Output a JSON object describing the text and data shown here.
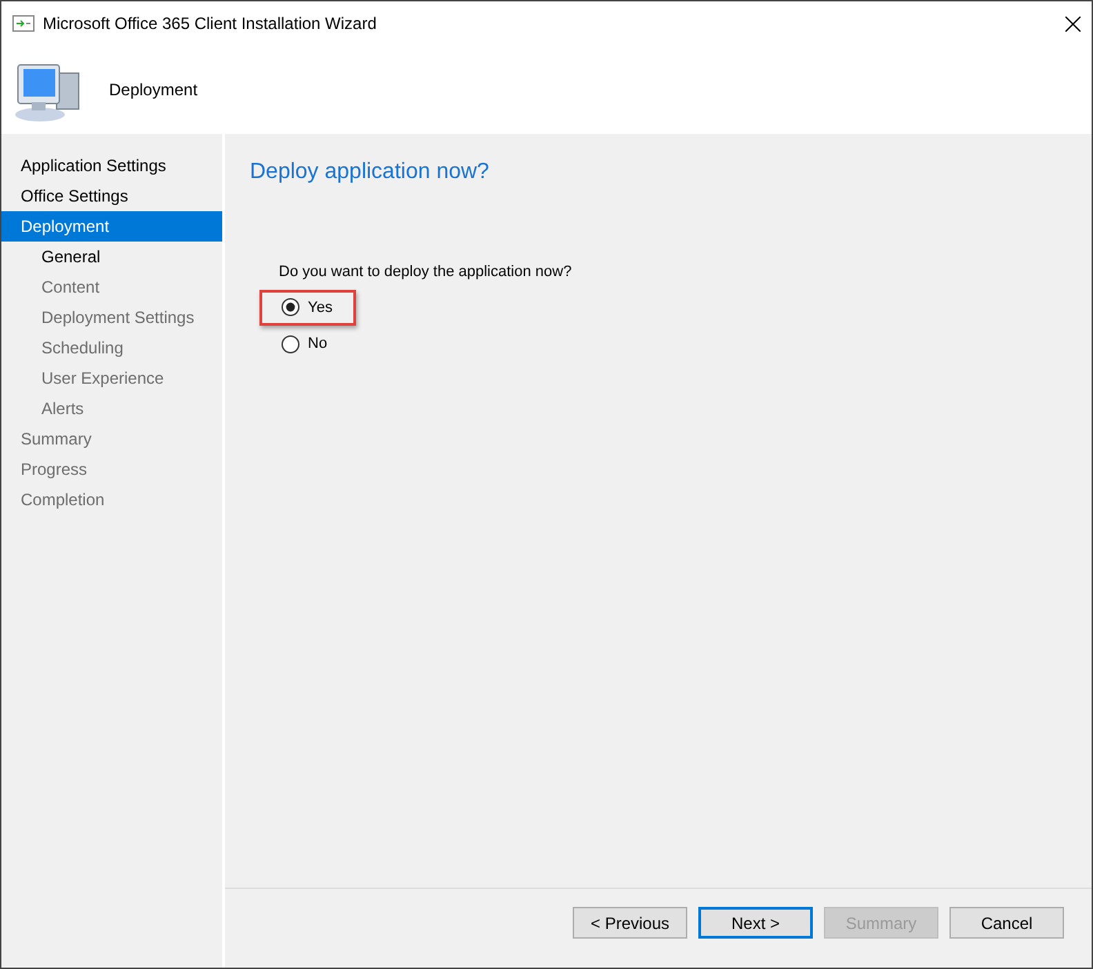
{
  "window": {
    "title": "Microsoft Office 365 Client Installation Wizard"
  },
  "header": {
    "title": "Deployment"
  },
  "sidebar": {
    "items": [
      {
        "label": "Application Settings",
        "selected": false,
        "disabled": false
      },
      {
        "label": "Office Settings",
        "selected": false,
        "disabled": false
      },
      {
        "label": "Deployment",
        "selected": true,
        "disabled": false,
        "children": [
          {
            "label": "General",
            "selected": false,
            "disabled": false
          },
          {
            "label": "Content",
            "selected": false,
            "disabled": true
          },
          {
            "label": "Deployment Settings",
            "selected": false,
            "disabled": true
          },
          {
            "label": "Scheduling",
            "selected": false,
            "disabled": true
          },
          {
            "label": "User Experience",
            "selected": false,
            "disabled": true
          },
          {
            "label": "Alerts",
            "selected": false,
            "disabled": true
          }
        ]
      },
      {
        "label": "Summary",
        "selected": false,
        "disabled": true
      },
      {
        "label": "Progress",
        "selected": false,
        "disabled": true
      },
      {
        "label": "Completion",
        "selected": false,
        "disabled": true
      }
    ]
  },
  "content": {
    "heading": "Deploy application now?",
    "question": "Do you want to deploy the application now?",
    "options": [
      {
        "label": "Yes",
        "selected": true,
        "highlighted": true
      },
      {
        "label": "No",
        "selected": false,
        "highlighted": false
      }
    ]
  },
  "buttons": [
    {
      "label": "< Previous",
      "default": false,
      "disabled": false
    },
    {
      "label": "Next >",
      "default": true,
      "disabled": false
    },
    {
      "label": "Summary",
      "default": false,
      "disabled": true
    },
    {
      "label": "Cancel",
      "default": false,
      "disabled": false
    }
  ]
}
